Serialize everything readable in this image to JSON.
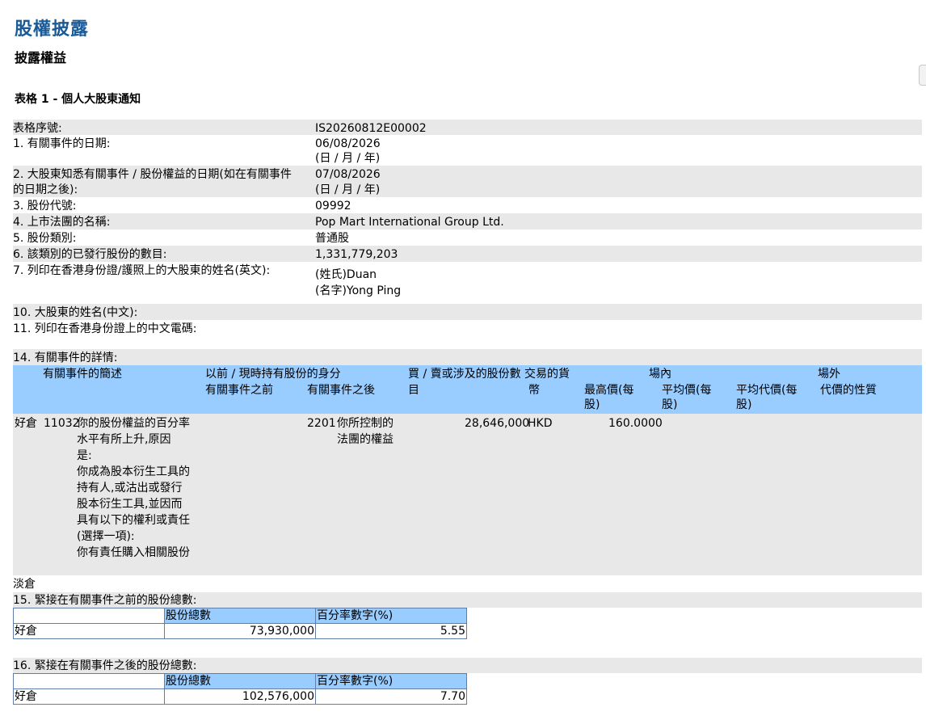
{
  "header": {
    "main_title": "股權披露",
    "sub_title": "披露權益",
    "table_title": "表格 1 - 個人大股東通知"
  },
  "fields": [
    {
      "label": "表格序號:",
      "value": "IS20260812E00002",
      "value2": ""
    },
    {
      "label": "1. 有關事件的日期:",
      "value": "06/08/2026",
      "value2": "(日 / 月 / 年)"
    },
    {
      "label": "2. 大股東知悉有關事件 / 股份權益的日期(如在有關事件",
      "label2": "的日期之後):",
      "value": "07/08/2026",
      "value2": "(日 / 月 / 年)"
    },
    {
      "label": "3. 股份代號:",
      "value": "09992"
    },
    {
      "label": "4. 上市法團的名稱:",
      "value": "Pop Mart International Group Ltd."
    },
    {
      "label": "5. 股份類別:",
      "value": "普通股"
    },
    {
      "label": "6. 該類別的已發行股份的數目:",
      "value": "1,331,779,203"
    },
    {
      "label": "7. 列印在香港身份證/護照上的大股東的姓名(英文):",
      "value": "(姓氏)Duan",
      "value2": "(名字)Yong Ping"
    },
    {
      "label": "10. 大股東的姓名(中文):"
    },
    {
      "label": "11. 列印在香港身份證上的中文電碼:"
    },
    {
      "label": "14. 有關事件的詳情:"
    }
  ],
  "event_table": {
    "headers": {
      "desc": "有關事件的簡述",
      "capacity": "以前 / 現時持有股份的身分",
      "before": "有關事件之前",
      "after": "有關事件之後",
      "shares": "買 / 賣或涉及的股份數",
      "shares2": "目",
      "currency": "交易的貨",
      "currency2": "幣",
      "onex": "場內",
      "highest": "最高價(每",
      "highest2": "股)",
      "avg": "平均價(每",
      "avg2": "股)",
      "offex": "場外",
      "avg_consideration": "平均代價(每",
      "avg_consideration2": "股)",
      "nature": "代價的性質"
    },
    "row": {
      "position": "好倉",
      "code": "11032",
      "desc_lines": [
        "你的股份權益的百分率",
        "水平有所上升,原因",
        "是:",
        "你成為股本衍生工具的",
        "持有人,或沽出或發行",
        "股本衍生工具,並因而",
        "具有以下的權利或責任",
        "(選擇一項):",
        "你有責任購入相關股份"
      ],
      "capacity_code": "2201",
      "capacity_lines": [
        "你所控制的",
        "法團的權益"
      ],
      "shares": "28,646,000",
      "currency": "HKD",
      "highest": "160.0000"
    },
    "short_label": "淡倉"
  },
  "before_totals": {
    "label": "15. 緊接在有關事件之前的股份總數:",
    "col_shares": "股份總數",
    "col_pct": "百分率數字(%)",
    "row_label": "好倉",
    "shares": "73,930,000",
    "pct": "5.55"
  },
  "after_totals": {
    "label": "16. 緊接在有關事件之後的股份總數:",
    "col_shares": "股份總數",
    "col_pct": "百分率數字(%)",
    "row_label": "好倉",
    "shares": "102,576,000",
    "pct": "7.70"
  }
}
